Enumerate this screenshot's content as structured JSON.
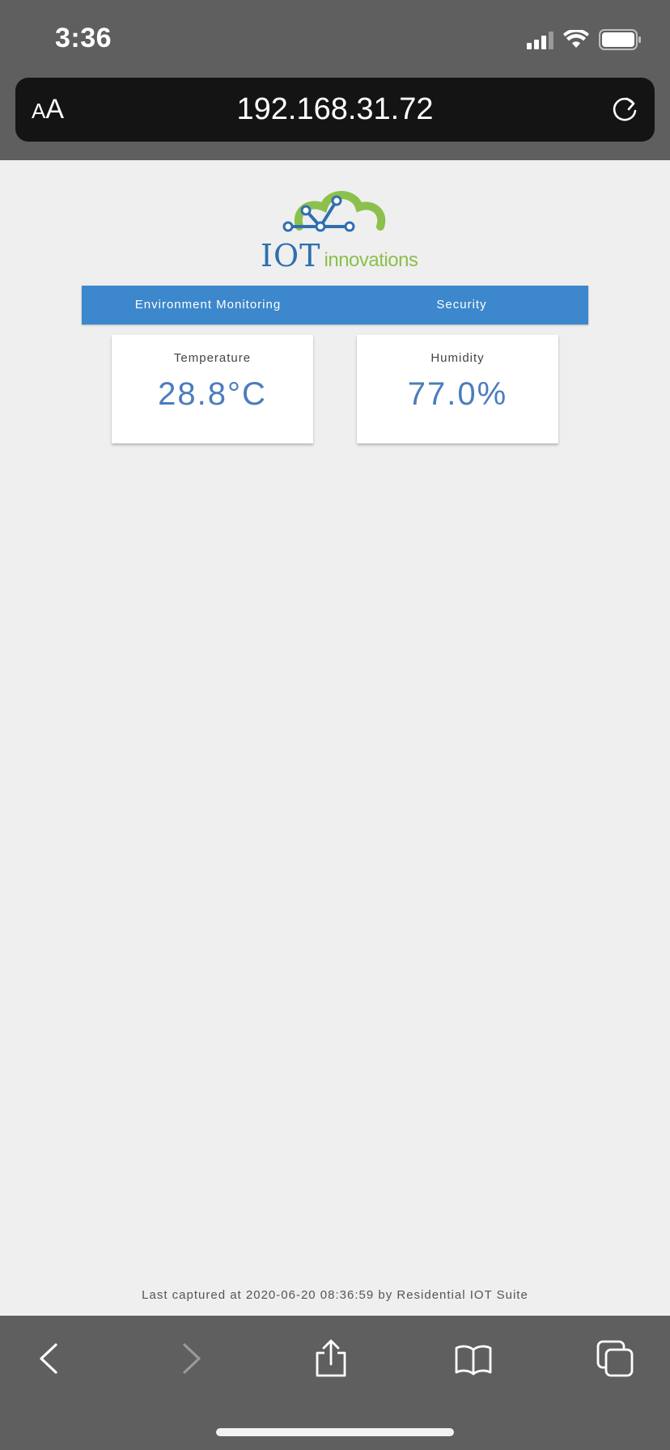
{
  "status_bar": {
    "time": "3:36"
  },
  "browser": {
    "text_size_label_small": "A",
    "text_size_label_big": "A",
    "url": "192.168.31.72"
  },
  "logo": {
    "brand_main": "IOT",
    "brand_sub": "innovations"
  },
  "nav": {
    "items": [
      {
        "label": "Environment Monitoring"
      },
      {
        "label": "Security"
      }
    ]
  },
  "cards": [
    {
      "label": "Temperature",
      "value": "28.8°C"
    },
    {
      "label": "Humidity",
      "value": "77.0%"
    }
  ],
  "footer": {
    "text": "Last captured at 2020-06-20 08:36:59 by Residential IOT Suite"
  },
  "colors": {
    "nav_bg": "#3d87cc",
    "value_text": "#4b7dbd",
    "logo_blue": "#2f6fb0",
    "logo_green": "#8cc04c",
    "browser_chrome": "#5f5f5f"
  }
}
